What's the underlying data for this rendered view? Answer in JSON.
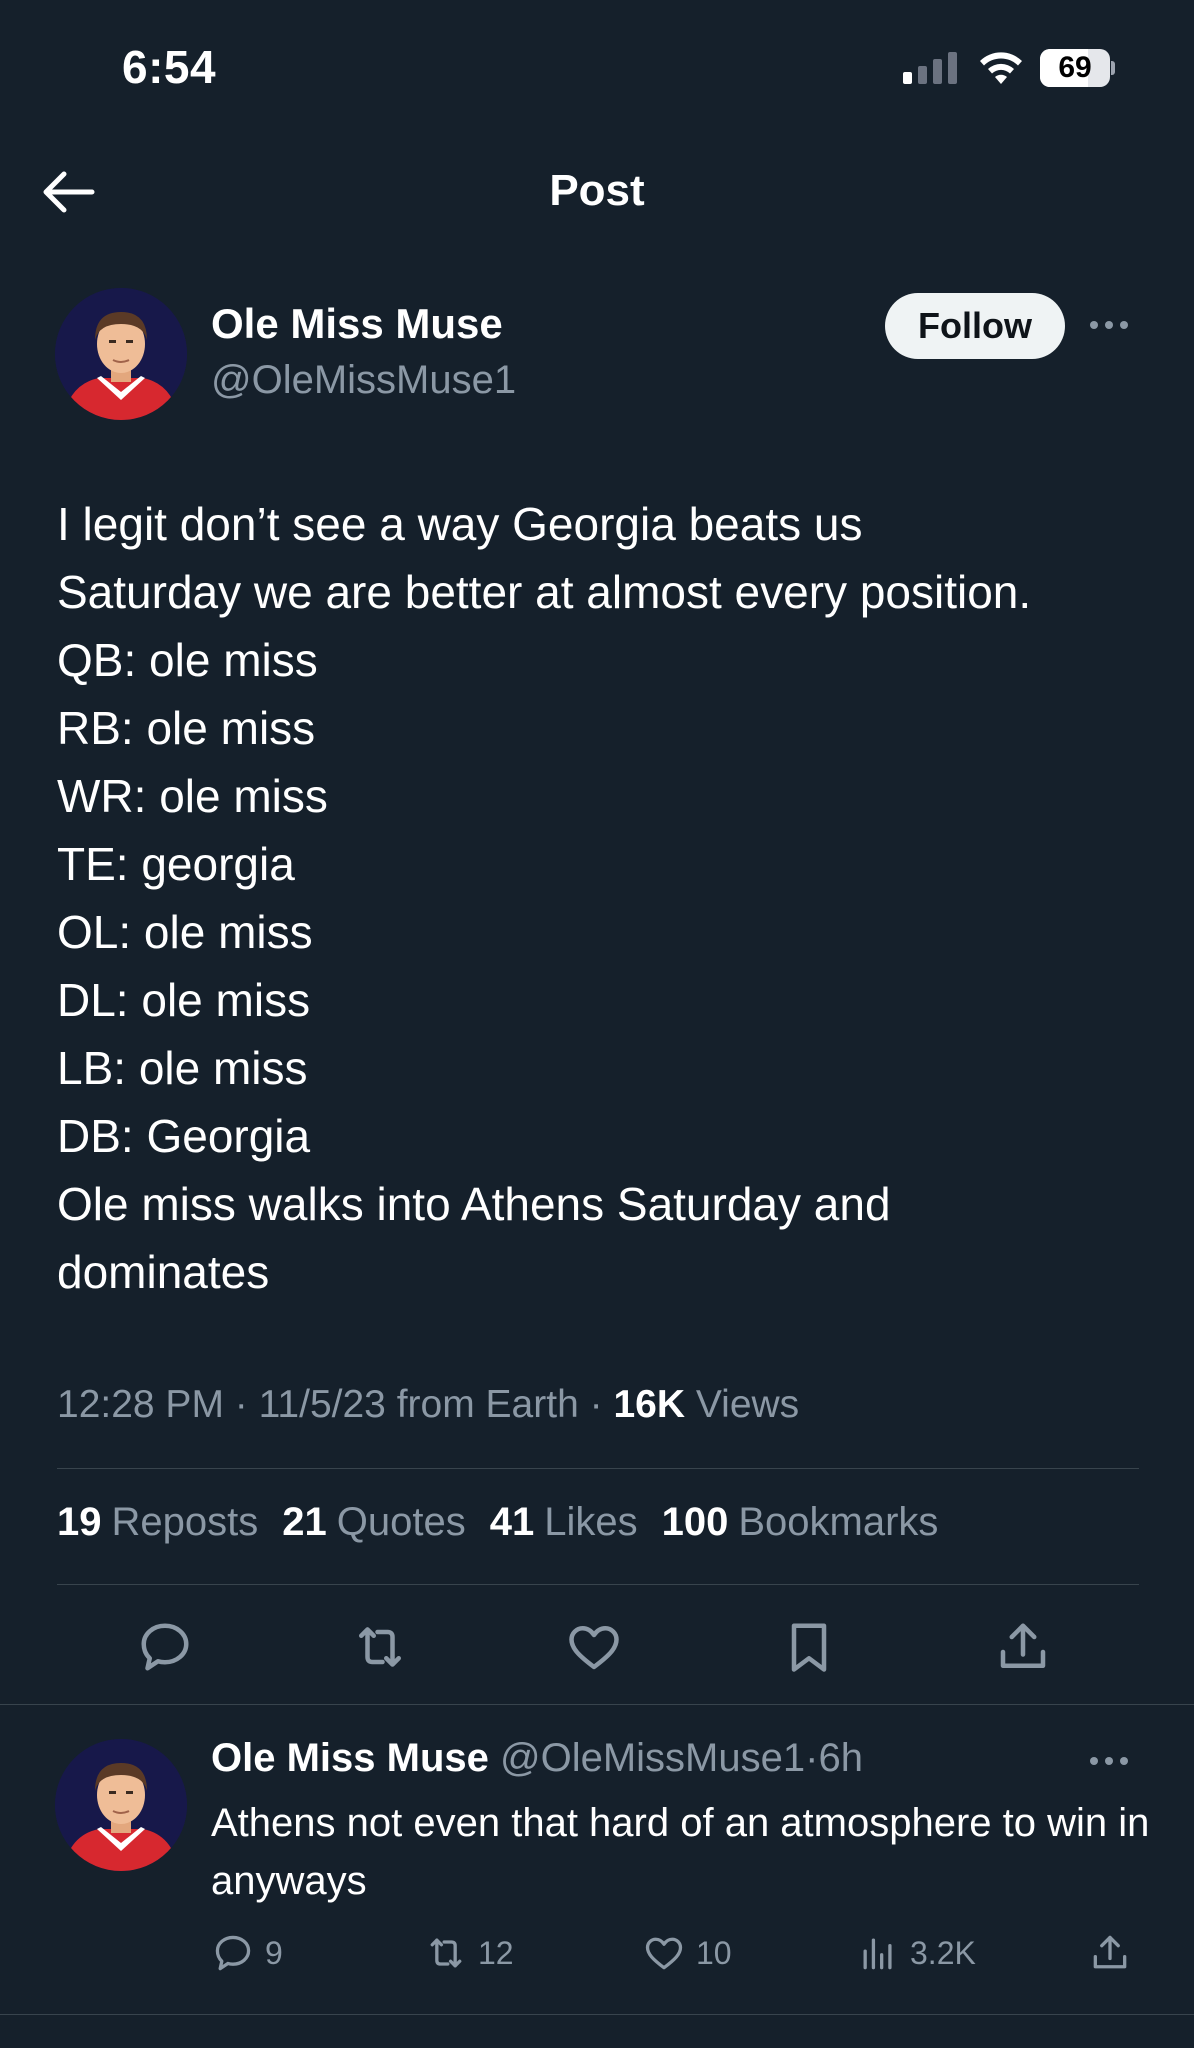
{
  "status_bar": {
    "time": "6:54",
    "battery": "69",
    "battery_level": 0.69
  },
  "header": {
    "title": "Post"
  },
  "post": {
    "author": {
      "name": "Ole Miss Muse",
      "handle": "@OleMissMuse1"
    },
    "follow_label": "Follow",
    "lines": [
      "I legit don’t see a way Georgia beats us",
      "Saturday we are better at almost every position.",
      "QB: ole miss",
      "RB: ole miss",
      "WR: ole miss",
      "TE: georgia",
      "OL: ole miss",
      "DL: ole miss",
      "LB: ole miss",
      "DB: Georgia",
      "Ole miss walks into Athens Saturday and",
      "dominates"
    ],
    "meta": {
      "time": "12:28 PM",
      "date": "11/5/23",
      "source": "from Earth",
      "sep": "·",
      "views_count": "16K",
      "views_label": "Views"
    },
    "stats": {
      "reposts_count": "19",
      "reposts_label": "Reposts",
      "quotes_count": "21",
      "quotes_label": "Quotes",
      "likes_count": "41",
      "likes_label": "Likes",
      "bookmarks_count": "100",
      "bookmarks_label": "Bookmarks"
    },
    "actions": [
      "reply-icon",
      "repost-icon",
      "like-icon",
      "bookmark-icon",
      "share-icon"
    ]
  },
  "reply": {
    "name": "Ole Miss Muse",
    "handle": "@OleMissMuse1",
    "sep": "·",
    "age": "6h",
    "text": "Athens not even that hard of an atmosphere to win in anyways",
    "counts": {
      "replies": "9",
      "reposts": "12",
      "likes": "10",
      "views": "3.2K"
    }
  },
  "colors": {
    "background": "#15202b",
    "secondary_text": "#8b98a5",
    "divider": "#38444d",
    "follow_bg": "#eff3f4"
  }
}
